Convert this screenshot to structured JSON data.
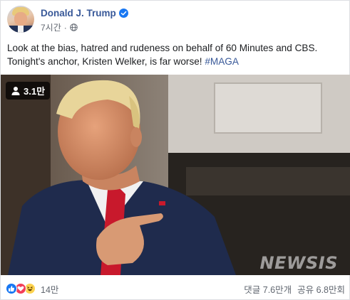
{
  "post": {
    "page_name": "Donald J. Trump",
    "time": "7시간",
    "text_main": "Look at the bias, hatred and rudeness on behalf of 60 Minutes and CBS. Tonight's anchor, Kristen Welker, is far worse! ",
    "hashtag": "#MAGA"
  },
  "video": {
    "views": "3.1만",
    "watermark": "NEWSIS"
  },
  "footer": {
    "reaction_count": "14만",
    "comments": "댓글 7.6만개",
    "shares": "공유 6.8만회"
  },
  "colors": {
    "link": "#385898",
    "verified": "#1877f2",
    "like": "#1877f2",
    "love": "#f33e58",
    "haha": "#fcd24f",
    "meta_text": "#616770"
  },
  "icons": [
    "verified-badge-icon",
    "globe-icon",
    "person-icon",
    "like-reaction-icon",
    "love-reaction-icon",
    "haha-reaction-icon"
  ]
}
